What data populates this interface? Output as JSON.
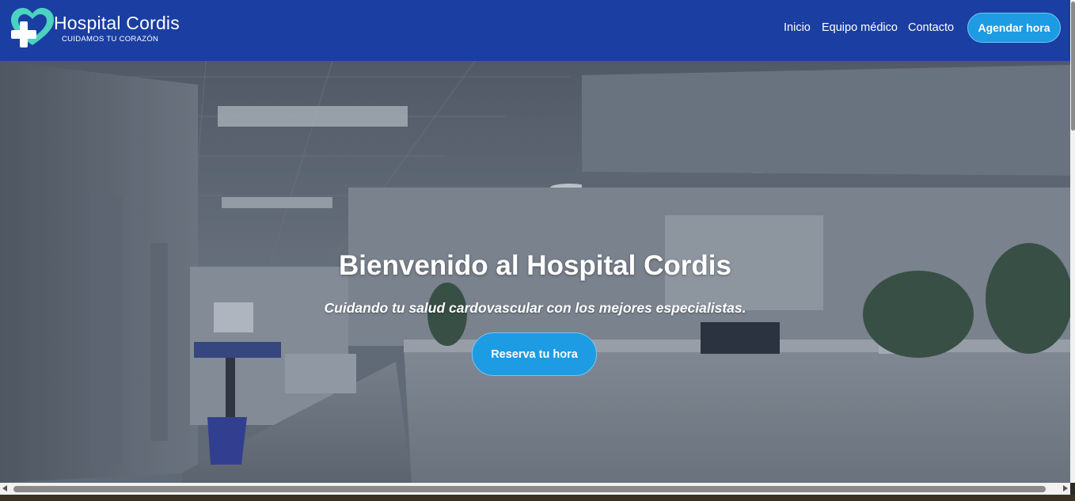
{
  "header": {
    "brand_name": "Hospital Cordis",
    "brand_tagline": "CUIDAMOS TU CORAZÓN",
    "nav": [
      {
        "label": "Inicio"
      },
      {
        "label": "Equipo médico"
      },
      {
        "label": "Contacto"
      }
    ],
    "cta_label": "Agendar hora"
  },
  "hero": {
    "title": "Bienvenido al Hospital Cordis",
    "subtitle": "Cuidando tu salud cardovascular con los mejores especialistas.",
    "button_label": "Reserva tu hora"
  },
  "colors": {
    "header_bg": "#1b3ea3",
    "accent_button": "#1d9be3",
    "logo_heart": "#49d3c0",
    "logo_cross": "#ffffff"
  },
  "icons": {
    "logo": "heart-cross-icon"
  }
}
